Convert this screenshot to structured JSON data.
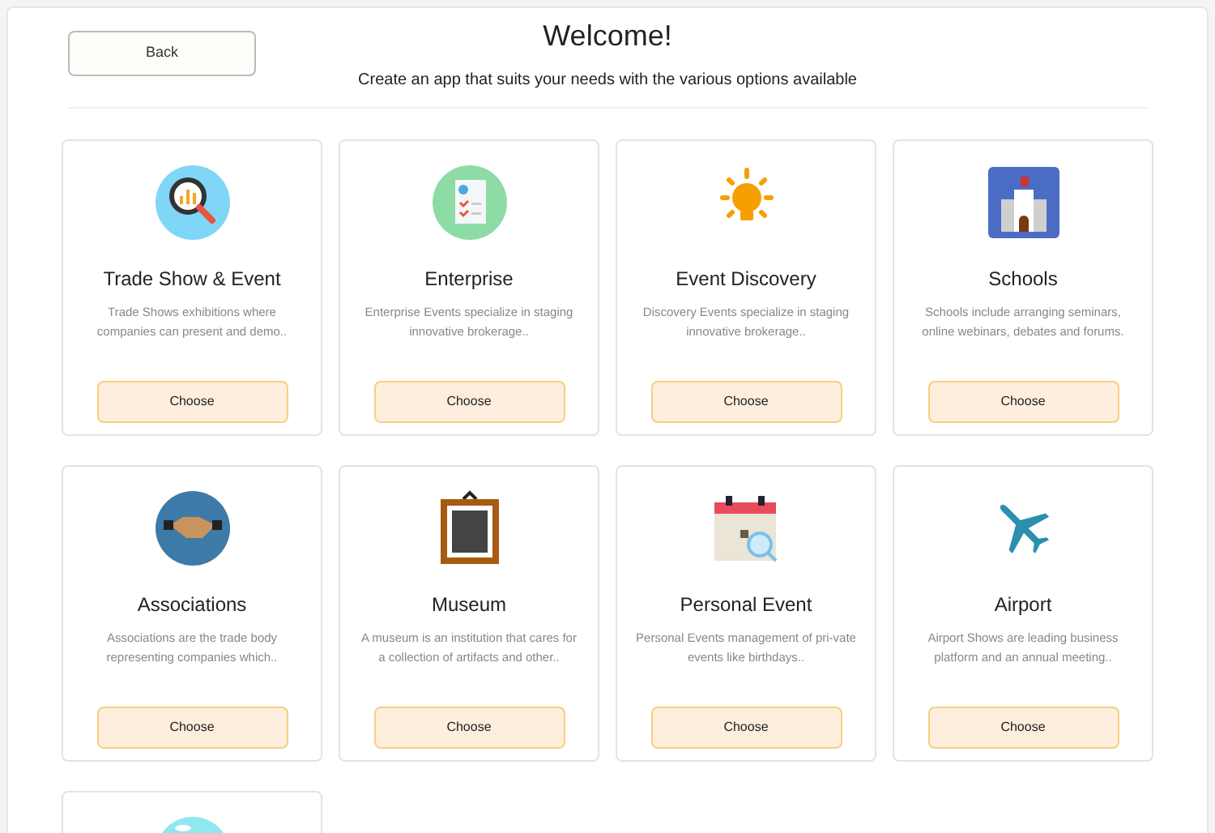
{
  "back_button": "Back",
  "title": "Welcome!",
  "subtitle": "Create an app that suits your needs with the various options available",
  "cards": [
    {
      "kind": "full",
      "title": "Trade Show & Event",
      "description": "Trade Shows exhibitions where companies can present and demo..",
      "button": "Choose"
    },
    {
      "kind": "full",
      "title": "Enterprise",
      "description": "Enterprise Events specialize in staging innovative brokerage..",
      "button": "Choose"
    },
    {
      "kind": "full",
      "title": "Event Discovery",
      "description": "Discovery Events specialize in staging innovative brokerage..",
      "button": "Choose"
    },
    {
      "kind": "full",
      "title": "Schools",
      "description": "Schools include arranging seminars, online webinars, debates and forums.",
      "button": "Choose"
    },
    {
      "kind": "full",
      "title": "Associations",
      "description": "Associations are  the trade body representing companies which..",
      "button": "Choose"
    },
    {
      "kind": "full",
      "title": "Museum",
      "description": "A museum is an institution that cares for  a collection of artifacts and other..",
      "button": "Choose"
    },
    {
      "kind": "full",
      "title": "Personal Event",
      "description": "Personal Events management of pri-vate events like birthdays..",
      "button": "Choose"
    },
    {
      "kind": "full",
      "title": "Airport",
      "description": "Airport Shows  are leading business platform and an annual meeting..",
      "button": "Choose"
    },
    {
      "kind": "partial"
    }
  ]
}
